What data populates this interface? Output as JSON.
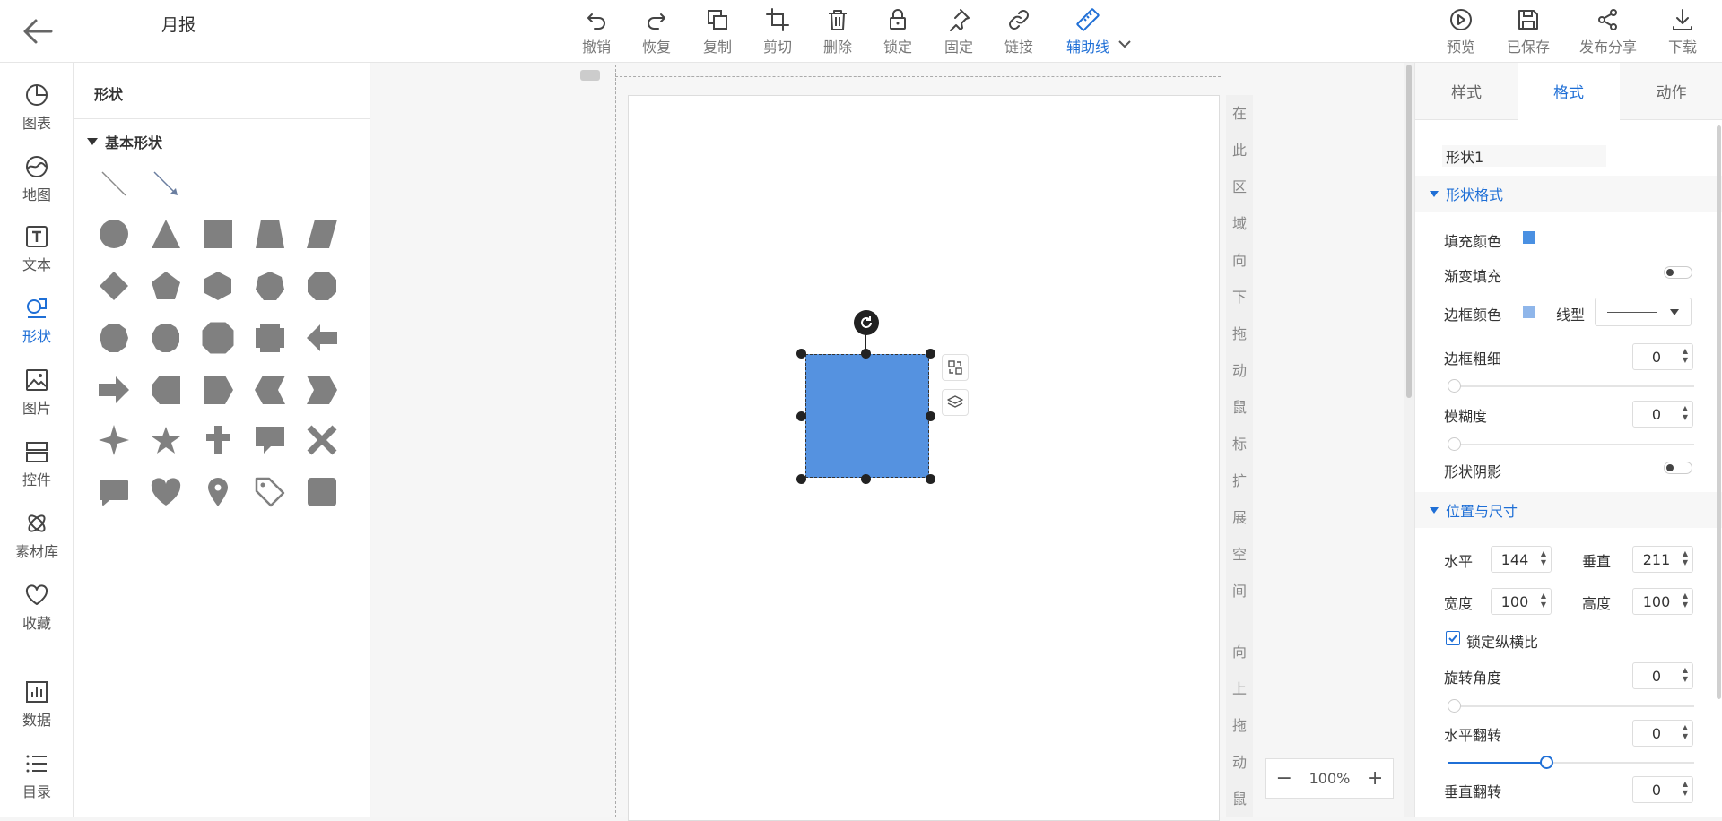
{
  "header": {
    "back_icon": "arrow-left-icon",
    "doc_title": "月报",
    "toolbar": {
      "undo": "撤销",
      "redo": "恢复",
      "copy": "复制",
      "cut": "剪切",
      "delete": "删除",
      "lock": "锁定",
      "pin": "固定",
      "link": "链接",
      "guides": "辅助线"
    },
    "right_actions": {
      "preview": "预览",
      "saved": "已保存",
      "share": "发布分享",
      "download": "下载"
    }
  },
  "left_nav": {
    "chart": "图表",
    "map": "地图",
    "text": "文本",
    "shape": "形状",
    "image": "图片",
    "control": "控件",
    "assets": "素材库",
    "favorites": "收藏",
    "data": "数据",
    "toc": "目录"
  },
  "shapes_panel": {
    "title": "形状",
    "group": "基本形状",
    "shape_color": "#808080"
  },
  "canvas": {
    "expand_down_chars": [
      "在",
      "此",
      "区",
      "域",
      "向",
      "下",
      "拖",
      "动",
      "鼠",
      "标",
      "扩",
      "展",
      "空",
      "间",
      "",
      "向",
      "上",
      "拖",
      "动",
      "鼠"
    ],
    "shape_fill": "#5592e0",
    "zoom": "100%",
    "zoom_minus": "−",
    "zoom_plus": "+"
  },
  "right_panel": {
    "tabs": {
      "style": "样式",
      "format": "格式",
      "action": "动作"
    },
    "shape_name": "形状1",
    "shape_format": {
      "header": "形状格式",
      "fill_color_label": "填充颜色",
      "fill_color": "#4a90e2",
      "gradient_label": "渐变填充",
      "border_color_label": "边框颜色",
      "border_color": "#8fb6ea",
      "line_type_label": "线型",
      "border_width_label": "边框粗细",
      "border_width": "0",
      "blur_label": "模糊度",
      "blur": "0",
      "shadow_label": "形状阴影"
    },
    "position_size": {
      "header": "位置与尺寸",
      "h_label": "水平",
      "h_value": "144",
      "v_label": "垂直",
      "v_value": "211",
      "w_label": "宽度",
      "w_value": "100",
      "height_label": "高度",
      "height_value": "100",
      "lock_ratio_label": "锁定纵横比",
      "rotation_label": "旋转角度",
      "rotation": "0",
      "flip_h_label": "水平翻转",
      "flip_h": "0",
      "flip_h_slider_level": 0.4,
      "flip_v_label": "垂直翻转",
      "flip_v": "0"
    }
  },
  "accent_color": "#1f6fd6"
}
